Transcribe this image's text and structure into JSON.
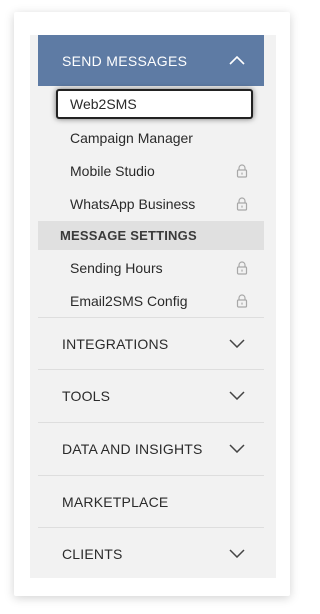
{
  "send_messages": {
    "title": "SEND MESSAGES",
    "expanded_icon": "chevron-up-icon",
    "items": [
      {
        "label": "Web2SMS",
        "selected": true,
        "locked": false
      },
      {
        "label": "Campaign Manager",
        "locked": false
      },
      {
        "label": "Mobile Studio",
        "locked": true
      },
      {
        "label": "WhatsApp Business",
        "locked": true
      }
    ]
  },
  "message_settings": {
    "title": "MESSAGE SETTINGS",
    "items": [
      {
        "label": "Sending Hours",
        "locked": true
      },
      {
        "label": "Email2SMS Config",
        "locked": true
      }
    ]
  },
  "sections": [
    {
      "label": "INTEGRATIONS",
      "icon": "chevron-down-icon"
    },
    {
      "label": "TOOLS",
      "icon": "chevron-down-icon"
    },
    {
      "label": "DATA AND INSIGHTS",
      "icon": "chevron-down-icon"
    },
    {
      "label": "MARKETPLACE"
    },
    {
      "label": "CLIENTS",
      "icon": "chevron-down-icon"
    }
  ],
  "colors": {
    "header_bg": "#5e7ba4",
    "menu_bg": "#f2f2f2",
    "section_bar_bg": "#e0e0e0",
    "text": "#2a2a2a",
    "lock_icon": "#a8a8a8"
  }
}
